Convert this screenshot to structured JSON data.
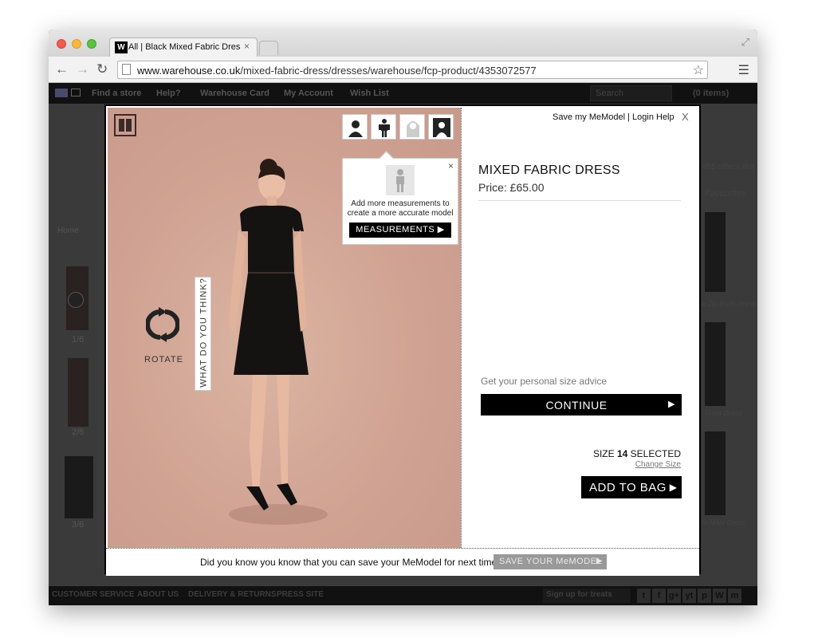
{
  "browser": {
    "tab_title": "All | Black Mixed Fabric Dres",
    "tab_favicon": "W",
    "url_host": "www.warehouse.co.uk",
    "url_path": "/mixed-fabric-dress/dresses/warehouse/fcp-product/4353072577"
  },
  "site": {
    "nav": [
      "Find a store",
      "Help?",
      "Warehouse Card",
      "My Account",
      "Wish List"
    ],
    "search_placeholder": "Search",
    "bag": "(0 items)",
    "others_text": "955 others like",
    "favourites": "Favourites",
    "breadcrumb_home": "Home",
    "thumb_labels": [
      "1/6",
      "2/6",
      "3/6"
    ],
    "right_labels": [
      "e Zip Back Dress",
      "Front Dress",
      "m Maxi Dress"
    ],
    "footer_links": [
      "CUSTOMER SERVICE",
      "ABOUT US",
      "DELIVERY & RETURNS",
      "PRESS SITE"
    ],
    "signup": "Sign up for treats",
    "social": [
      "t",
      "f",
      "g+",
      "yt",
      "p",
      "W",
      "m"
    ]
  },
  "modal": {
    "save_login": "Save my MeModel | Login",
    "help": "Help",
    "close": "X",
    "what_do_you_think": "WHAT DO YOU THINK?",
    "rotate_label": "ROTATE",
    "popup_text": "Add more measurements to create a more accurate model",
    "popup_close": "×",
    "measurements_label": "MEASUREMENTS ▶",
    "product_name": "MIXED FABRIC DRESS",
    "product_price": "Price: £65.00",
    "advice_text": "Get your personal size advice",
    "continue_label": "CONTINUE",
    "size_selected_pre": "SIZE ",
    "size_selected_num": "14",
    "size_selected_post": " SELECTED",
    "change_size": "Change Size",
    "add_to_bag": "ADD TO BAG",
    "footer_text": "Did you know you know that you can save your MeModel for next time?",
    "save_memodel_label": "SAVE YOUR MeMODEL"
  }
}
